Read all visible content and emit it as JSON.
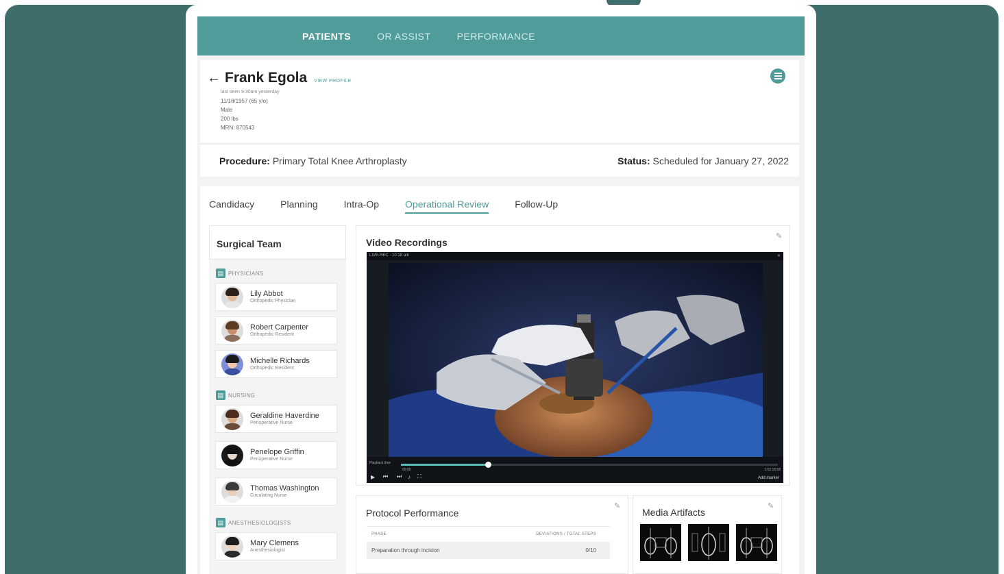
{
  "nav": {
    "items": [
      {
        "label": "PATIENTS",
        "active": true
      },
      {
        "label": "OR ASSIST",
        "active": false
      },
      {
        "label": "PERFORMANCE",
        "active": false
      }
    ]
  },
  "patient": {
    "name": "Frank Egola",
    "view_profile": "VIEW PROFILE",
    "last_seen": "last seen 9:30am yesterday",
    "dob": "11/18/1957 (65 y/o)",
    "sex": "Male",
    "weight": "200 lbs",
    "mrn": "MRN: 870543"
  },
  "procedure": {
    "label": "Procedure:",
    "value": "Primary Total Knee Arthroplasty",
    "status_label": "Status:",
    "status_value": "Scheduled for January 27, 2022"
  },
  "tabs": [
    {
      "label": "Candidacy",
      "active": false
    },
    {
      "label": "Planning",
      "active": false
    },
    {
      "label": "Intra-Op",
      "active": false
    },
    {
      "label": "Operational Review",
      "active": true
    },
    {
      "label": "Follow-Up",
      "active": false
    }
  ],
  "team": {
    "title": "Surgical Team",
    "groups": [
      {
        "label": "PHYSICIANS",
        "members": [
          {
            "name": "Lily Abbot",
            "role": "Orthopedic Physician"
          },
          {
            "name": "Robert Carpenter",
            "role": "Orthopedic Resident"
          },
          {
            "name": "Michelle Richards",
            "role": "Orthopedic Resident"
          }
        ]
      },
      {
        "label": "NURSING",
        "members": [
          {
            "name": "Geraldine Haverdine",
            "role": "Perioperative Nurse"
          },
          {
            "name": "Penelope Griffin",
            "role": "Perioperative Nurse"
          },
          {
            "name": "Thomas Washington",
            "role": "Circulating Nurse"
          }
        ]
      },
      {
        "label": "ANESTHESIOLOGISTS",
        "members": [
          {
            "name": "Mary Clemens",
            "role": "Anesthesiologist"
          }
        ]
      }
    ]
  },
  "video": {
    "title": "Video Recordings",
    "file_label": "LIVE-REC · 10:18 am",
    "playback_label": "Playback time",
    "time_start": "00:00",
    "time_end": "1:52:16:58",
    "action_label": "Add marker",
    "progress": 0.23
  },
  "protocol": {
    "title": "Protocol Performance",
    "col_phase": "PHASE",
    "col_deviations": "DEVIATIONS / TOTAL STEPS",
    "rows": [
      {
        "phase": "Preparation through incision",
        "value": "0/10"
      }
    ]
  },
  "media": {
    "title": "Media Artifacts",
    "thumbnails": [
      "knee-xray-scan",
      "knee-xray-lateral",
      "knee-xray-scan"
    ]
  },
  "colors": {
    "brand": "#4f9c9a",
    "background": "#3e6e6c"
  }
}
